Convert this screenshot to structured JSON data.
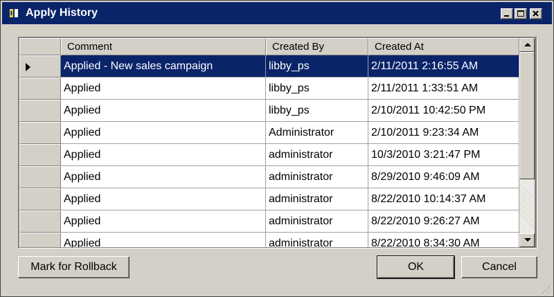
{
  "window": {
    "title": "Apply History",
    "title_color": "#ffffff",
    "titlebar_color": "#0a246a",
    "controls": [
      "minimize-icon",
      "maximize-icon",
      "close-icon"
    ]
  },
  "grid": {
    "columns": [
      "Comment",
      "Created By",
      "Created At"
    ],
    "selected_row_index": 0,
    "selection_color": "#0a246a",
    "rows": [
      {
        "comment": "Applied - New sales campaign",
        "created_by": "libby_ps",
        "created_at": "2/11/2011 2:16:55 AM"
      },
      {
        "comment": "Applied",
        "created_by": "libby_ps",
        "created_at": "2/11/2011 1:33:51 AM"
      },
      {
        "comment": "Applied",
        "created_by": "libby_ps",
        "created_at": "2/10/2011 10:42:50 PM"
      },
      {
        "comment": "Applied",
        "created_by": "Administrator",
        "created_at": "2/10/2011 9:23:34 AM"
      },
      {
        "comment": "Applied",
        "created_by": "administrator",
        "created_at": "10/3/2010 3:21:47 PM"
      },
      {
        "comment": "Applied",
        "created_by": "administrator",
        "created_at": "8/29/2010 9:46:09 AM"
      },
      {
        "comment": "Applied",
        "created_by": "administrator",
        "created_at": "8/22/2010 10:14:37 AM"
      },
      {
        "comment": "Applied",
        "created_by": "administrator",
        "created_at": "8/22/2010 9:26:27 AM"
      },
      {
        "comment": "Applied",
        "created_by": "administrator",
        "created_at": "8/22/2010 8:34:30 AM"
      }
    ]
  },
  "buttons": {
    "rollback": "Mark for Rollback",
    "ok": "OK",
    "cancel": "Cancel"
  }
}
